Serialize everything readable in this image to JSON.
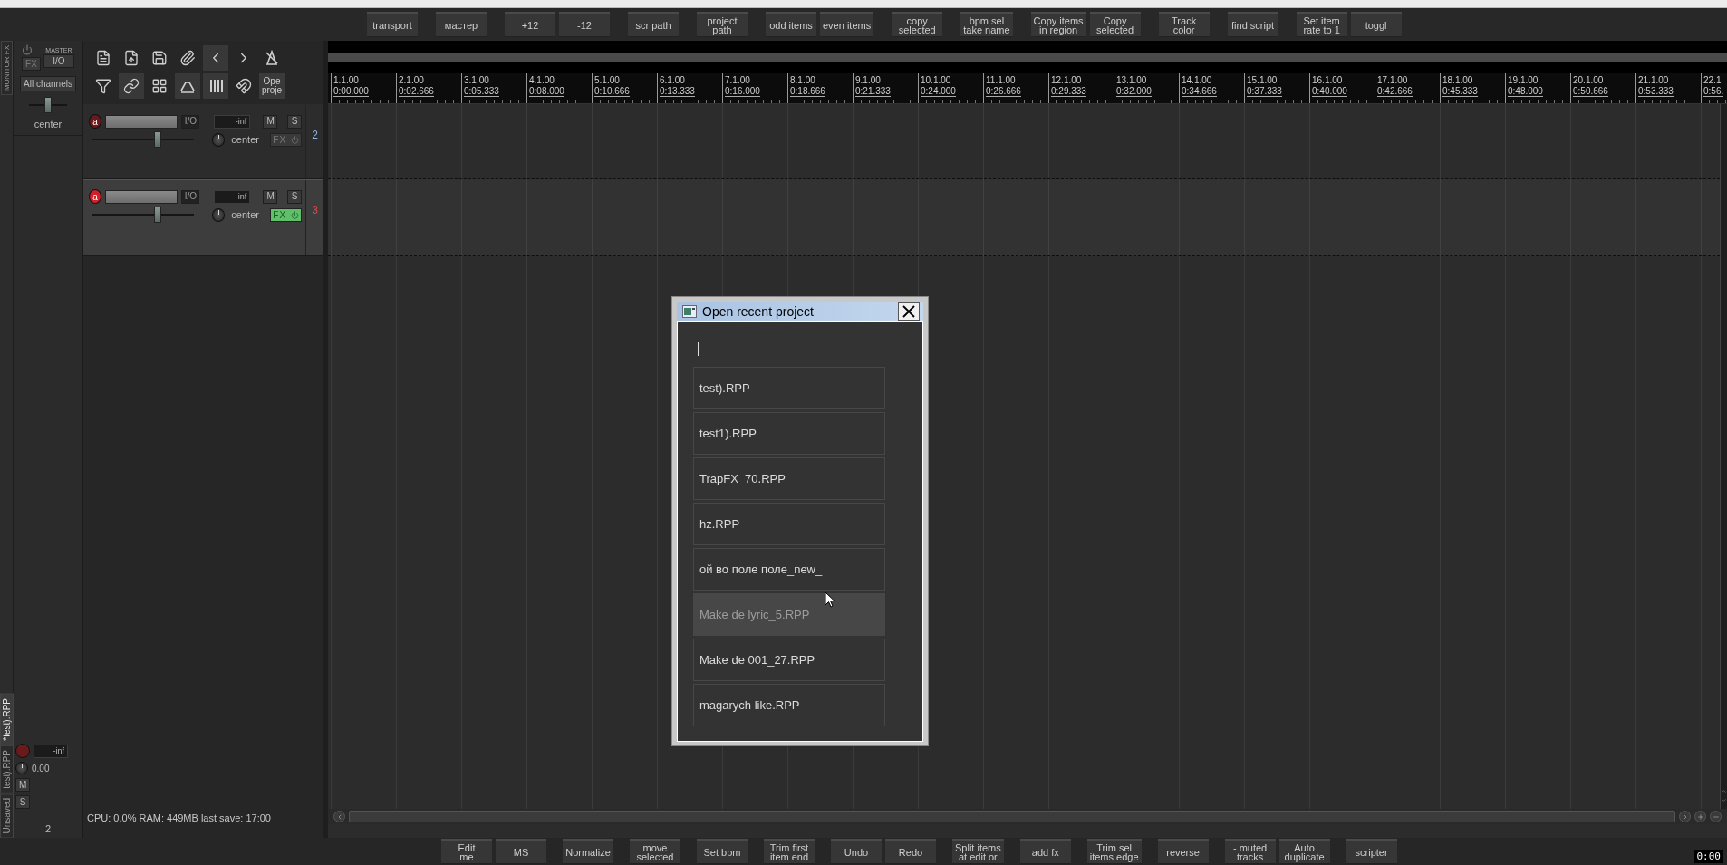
{
  "top_toolbar": [
    [
      "transport"
    ],
    [
      "мастер"
    ],
    [
      "+12",
      "-12"
    ],
    [
      "scr path"
    ],
    [
      "project\npath"
    ],
    [
      "odd items",
      "even items"
    ],
    [
      "copy\nselected"
    ],
    [
      "bpm sel\ntake name"
    ],
    [
      "Copy items\nin region",
      "Copy\nselected"
    ],
    [
      "Track\ncolor"
    ],
    [
      "find script"
    ],
    [
      "Set item\nrate to 1",
      "toggl"
    ]
  ],
  "monitor_fx": "MONITOR FX",
  "master": {
    "fx": "FX",
    "label": "MASTER",
    "io": "I/O",
    "channels": "All channels",
    "pan_slider": {
      "level": 0.5
    },
    "pan": "center"
  },
  "tool_text_button": "Ope\nproje",
  "tracks": [
    {
      "number": "2",
      "arm_label": "a",
      "io": "I/O",
      "meter": "-inf",
      "mute": "M",
      "solo": "S",
      "volume": {
        "level": 0.62
      },
      "pan": "center",
      "fx": "FX",
      "armed": false,
      "fx_active": false,
      "selected": false
    },
    {
      "number": "3",
      "arm_label": "a",
      "io": "I/O",
      "meter": "-inf",
      "mute": "M",
      "solo": "S",
      "volume": {
        "level": 0.62
      },
      "pan": "center",
      "fx": "FX",
      "armed": true,
      "fx_active": true,
      "selected": true
    }
  ],
  "ruler": [
    {
      "bar": "1.1.00",
      "time": "0:00.000"
    },
    {
      "bar": "2.1.00",
      "time": "0:02.666"
    },
    {
      "bar": "3.1.00",
      "time": "0:05.333"
    },
    {
      "bar": "4.1.00",
      "time": "0:08.000"
    },
    {
      "bar": "5.1.00",
      "time": "0:10.666"
    },
    {
      "bar": "6.1.00",
      "time": "0:13.333"
    },
    {
      "bar": "7.1.00",
      "time": "0:16.000"
    },
    {
      "bar": "8.1.00",
      "time": "0:18.666"
    },
    {
      "bar": "9.1.00",
      "time": "0:21.333"
    },
    {
      "bar": "10.1.00",
      "time": "0:24.000"
    },
    {
      "bar": "11.1.00",
      "time": "0:26.666"
    },
    {
      "bar": "12.1.00",
      "time": "0:29.333"
    },
    {
      "bar": "13.1.00",
      "time": "0:32.000"
    },
    {
      "bar": "14.1.00",
      "time": "0:34.666"
    },
    {
      "bar": "15.1.00",
      "time": "0:37.333"
    },
    {
      "bar": "16.1.00",
      "time": "0:40.000"
    },
    {
      "bar": "17.1.00",
      "time": "0:42.666"
    },
    {
      "bar": "18.1.00",
      "time": "0:45.333"
    },
    {
      "bar": "19.1.00",
      "time": "0:48.000"
    },
    {
      "bar": "20.1.00",
      "time": "0:50.666"
    },
    {
      "bar": "21.1.00",
      "time": "0:53.333"
    },
    {
      "bar": "22.1",
      "time": "0:56."
    }
  ],
  "status": "CPU: 0.0% RAM: 449MB last save: 17:00",
  "mini_mixer": {
    "meter": "-inf",
    "volume": "0.00",
    "mute": "M",
    "solo": "S",
    "track_number": "2"
  },
  "project_tabs": [
    {
      "label": "*test).RPP",
      "selected": true
    },
    {
      "label": "test).RPP",
      "selected": false
    },
    {
      "label": "Unsaved",
      "selected": false
    }
  ],
  "bottom_toolbar": [
    [
      "Edit\nme",
      "MS"
    ],
    [
      "Normalize"
    ],
    [
      "move\nselected"
    ],
    [
      "Set bpm"
    ],
    [
      "Trim first\nitem end"
    ],
    [
      "Undo",
      "Redo"
    ],
    [
      "Split items\nat edit or"
    ],
    [
      "add fx"
    ],
    [
      "Trim sel\nitems edge"
    ],
    [
      "reverse"
    ],
    [
      "- muted\ntracks",
      "Auto\nduplicate"
    ],
    [
      "scripter"
    ]
  ],
  "clock": "0:00",
  "dialog": {
    "title": "Open recent project",
    "items": [
      {
        "name": "test).RPP",
        "highlighted": false
      },
      {
        "name": "test1).RPP",
        "highlighted": false
      },
      {
        "name": "TrapFX_70.RPP",
        "highlighted": false
      },
      {
        "name": "hz.RPP",
        "highlighted": false
      },
      {
        "name": "ой во поле поле_new_",
        "highlighted": false
      },
      {
        "name": "Make de lyric_5.RPP",
        "highlighted": true
      },
      {
        "name": "Make de 001_27.RPP",
        "highlighted": false
      },
      {
        "name": "magarych like.RPP",
        "highlighted": false
      }
    ]
  }
}
